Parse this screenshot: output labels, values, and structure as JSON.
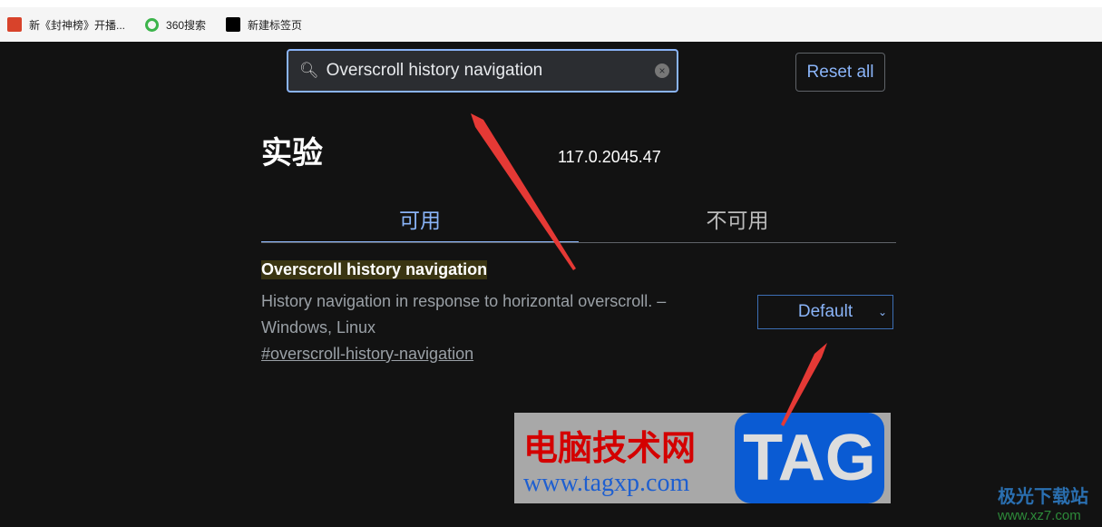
{
  "bookmarks": [
    {
      "label": "新《封神榜》开播...",
      "icon": "kuai-icon"
    },
    {
      "label": "360搜索",
      "icon": "360-icon"
    },
    {
      "label": "新建标签页",
      "icon": "black-square-icon"
    }
  ],
  "search": {
    "value": "Overscroll history navigation"
  },
  "reset_label": "Reset all",
  "page_title": "实验",
  "version": "117.0.2045.47",
  "tabs": [
    {
      "label": "可用",
      "active": true
    },
    {
      "label": "不可用",
      "active": false
    }
  ],
  "flag": {
    "name": "Overscroll history navigation",
    "description": "History navigation in response to horizontal overscroll. – Windows, Linux",
    "link": "#overscroll-history-navigation",
    "value": "Default"
  },
  "watermark": {
    "cn": "电脑技术网",
    "url": "www.tagxp.com",
    "tag": "TAG",
    "site": "极光下载站",
    "site_url": "www.xz7.com"
  },
  "colors": {
    "accent": "#8ab4f8",
    "arrow": "#e53935"
  }
}
